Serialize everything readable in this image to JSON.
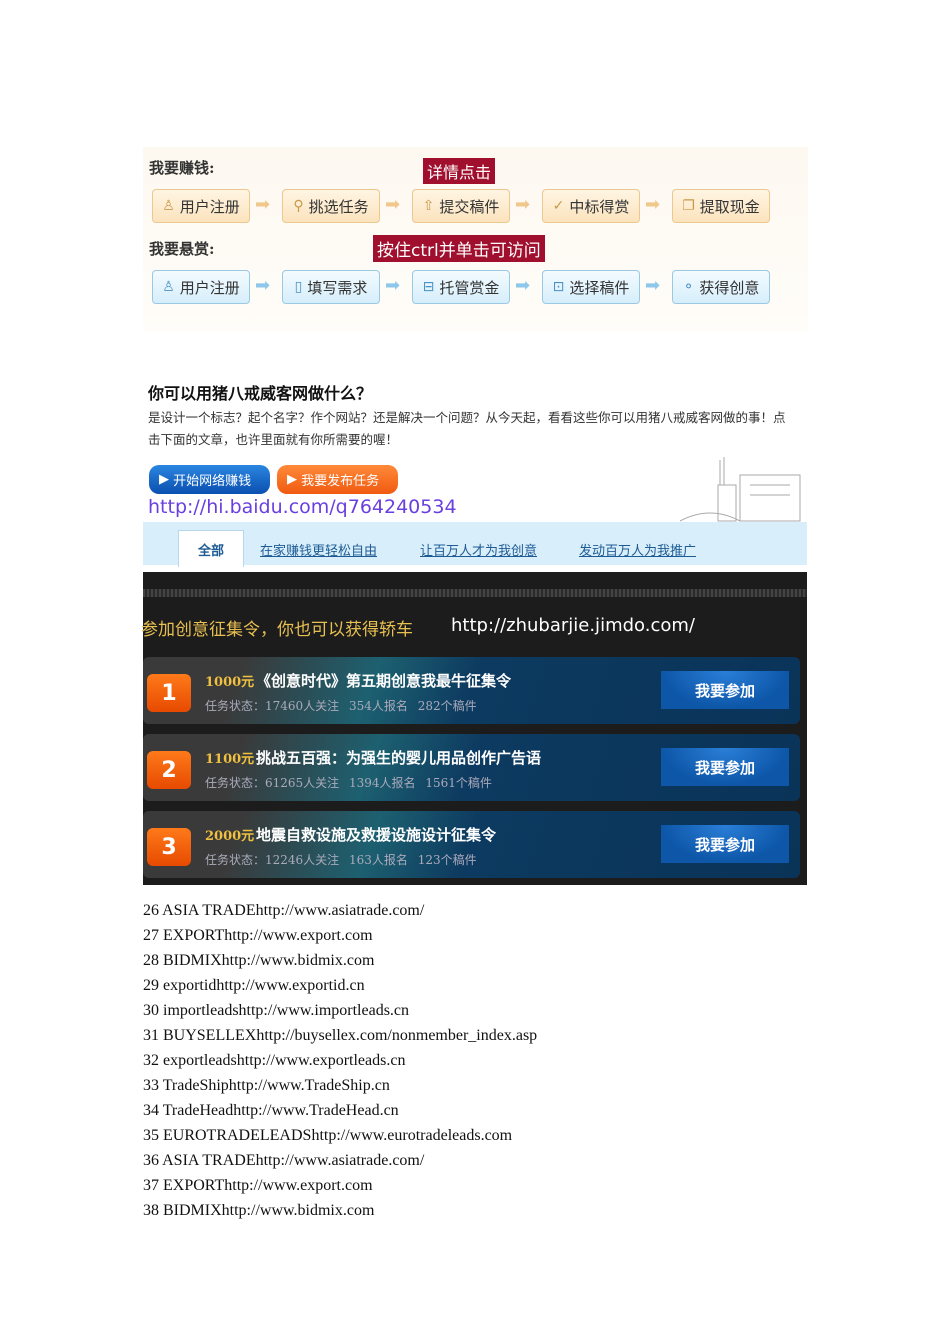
{
  "flow": {
    "earn_label": "我要赚钱:",
    "earn_tag": "详情点击",
    "earn_steps": [
      {
        "icon": "user-icon",
        "label": "用户注册"
      },
      {
        "icon": "search-icon",
        "label": "挑选任务"
      },
      {
        "icon": "upload-icon",
        "label": "提交稿件"
      },
      {
        "icon": "check-icon",
        "label": "中标得赏"
      },
      {
        "icon": "copy-icon",
        "label": "提取现金"
      }
    ],
    "reward_label": "我要悬赏:",
    "reward_tag": "按住ctrl并单击可访问",
    "reward_steps": [
      {
        "icon": "user-icon",
        "label": "用户注册"
      },
      {
        "icon": "document-icon",
        "label": "填写需求"
      },
      {
        "icon": "cart-icon",
        "label": "托管赏金"
      },
      {
        "icon": "folder-icon",
        "label": "选择稿件"
      },
      {
        "icon": "idea-icon",
        "label": "获得创意"
      }
    ]
  },
  "intro": {
    "title": "你可以用猪八戒威客网做什么？",
    "text": "是设计一个标志？起个名字？作个网站？还是解决一个问题？从今天起，看看这些你可以用猪八戒威客网做的事！点击下面的文章，也许里面就有你所需要的喔！",
    "btn_earn": "开始网络赚钱",
    "btn_publish": "我要发布任务",
    "url": "http://hi.baidu.com/q764240534",
    "tabs": [
      "全部",
      "在家赚钱更轻松自由",
      "让百万人才为我创意",
      "发动百万人为我推广"
    ]
  },
  "contest": {
    "heading": "参加创意征集令，你也可以获得轿车",
    "url": "http://zhubarjie.jimdo.com/",
    "join_label": "我要参加",
    "items": [
      {
        "num": "1",
        "prize": "1000元",
        "title": "《创意时代》第五期创意我最牛征集令",
        "status": "任务状态：17460人关注 354人报名 282个稿件"
      },
      {
        "num": "2",
        "prize": "1100元",
        "title": "挑战五百强：为强生的婴儿用品创作广告语",
        "status": "任务状态：61265人关注 1394人报名 1561个稿件"
      },
      {
        "num": "3",
        "prize": "2000元",
        "title": "地震自救设施及救援设施设计征集令",
        "status": "任务状态：12246人关注 163人报名 123个稿件"
      }
    ]
  },
  "list": [
    "26 ASIA TRADEhttp://www.asiatrade.com/",
    "27 EXPORThttp://www.export.com",
    "28 BIDMIXhttp://www.bidmix.com",
    "29 exportidhttp://www.exportid.cn",
    "30 importleadshttp://www.importleads.cn",
    "31 BUYSELLEXhttp://buysellex.com/nonmember_index.asp",
    "32 exportleadshttp://www.exportleads.cn",
    "33 TradeShiphttp://www.TradeShip.cn",
    "34 TradeHeadhttp://www.TradeHead.cn",
    "35 EUROTRADELEADShttp://www.eurotradeleads.com",
    "36 ASIA TRADEhttp://www.asiatrade.com/",
    "37 EXPORThttp://www.export.com",
    "38 BIDMIXhttp://www.bidmix.com"
  ]
}
